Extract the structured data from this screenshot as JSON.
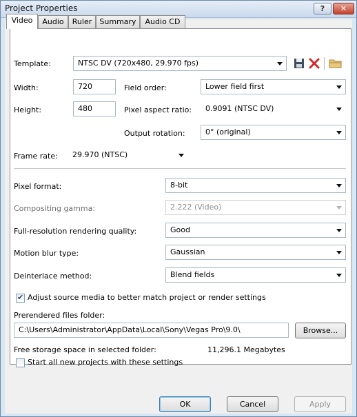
{
  "window": {
    "title": "Project Properties",
    "help_label": "?",
    "close_label": "✕"
  },
  "tabs": [
    {
      "label": "Video",
      "active": true
    },
    {
      "label": "Audio"
    },
    {
      "label": "Ruler"
    },
    {
      "label": "Summary"
    },
    {
      "label": "Audio CD"
    }
  ],
  "video": {
    "template_label": "Template:",
    "template_value": "NTSC DV (720x480, 29.970 fps)",
    "width_label": "Width:",
    "width_value": "720",
    "height_label": "Height:",
    "height_value": "480",
    "field_order_label": "Field order:",
    "field_order_value": "Lower field first",
    "pixel_aspect_label": "Pixel aspect ratio:",
    "pixel_aspect_value": "0.9091 (NTSC DV)",
    "output_rotation_label": "Output rotation:",
    "output_rotation_value": "0° (original)",
    "frame_rate_label": "Frame rate:",
    "frame_rate_value": "29.970 (NTSC)",
    "pixel_format_label": "Pixel format:",
    "pixel_format_value": "8-bit",
    "compositing_gamma_label": "Compositing gamma:",
    "compositing_gamma_value": "2.222 (Video)",
    "rendering_quality_label": "Full-resolution rendering quality:",
    "rendering_quality_value": "Good",
    "motion_blur_label": "Motion blur type:",
    "motion_blur_value": "Gaussian",
    "deinterlace_label": "Deinterlace method:",
    "deinterlace_value": "Blend fields",
    "adjust_source_label": "Adjust source media to better match project or render settings",
    "adjust_source_checked": true,
    "prerendered_label": "Prerendered files folder:",
    "prerendered_value": "C:\\Users\\Administrator\\AppData\\Local\\Sony\\Vegas Pro\\9.0\\",
    "browse_label": "Browse...",
    "free_storage_label": "Free storage space in selected folder:",
    "free_storage_value": "11,296.1 Megabytes",
    "start_new_label": "Start all new projects with these settings",
    "start_new_checked": false
  },
  "buttons": {
    "ok": "OK",
    "cancel": "Cancel",
    "apply": "Apply"
  },
  "icons": [
    "save-icon",
    "delete-icon",
    "open-folder-icon"
  ]
}
